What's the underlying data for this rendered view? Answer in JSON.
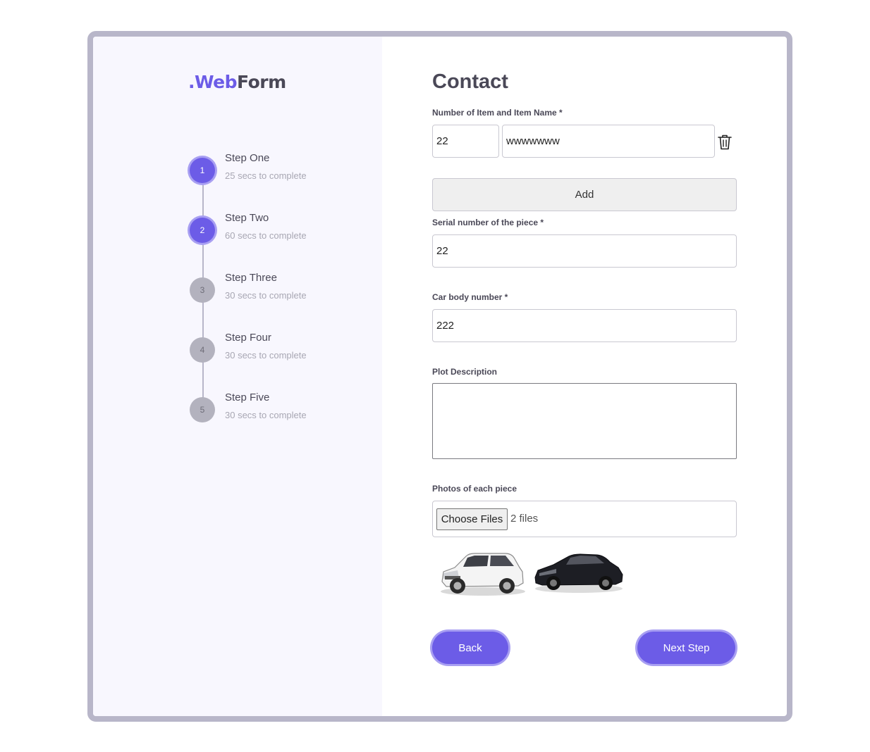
{
  "logo": {
    "part1": ".Web",
    "part2": "Form"
  },
  "steps": [
    {
      "number": "1",
      "title": "Step One",
      "subtitle": "25 secs to complete",
      "state": "active"
    },
    {
      "number": "2",
      "title": "Step Two",
      "subtitle": "60 secs to complete",
      "state": "active"
    },
    {
      "number": "3",
      "title": "Step Three",
      "subtitle": "30 secs to complete",
      "state": "inactive"
    },
    {
      "number": "4",
      "title": "Step Four",
      "subtitle": "30 secs to complete",
      "state": "inactive"
    },
    {
      "number": "5",
      "title": "Step Five",
      "subtitle": "30 secs to complete",
      "state": "inactive"
    }
  ],
  "form": {
    "title": "Contact",
    "item_label": "Number of Item and Item Name *",
    "item_number_value": "22",
    "item_name_value": "wwwwwww",
    "add_label": "Add",
    "serial_label": "Serial number of the piece *",
    "serial_value": "22",
    "body_label": "Car body number *",
    "body_value": "222",
    "plot_label": "Plot Description",
    "plot_value": "",
    "photos_label": "Photos of each piece",
    "choose_files_label": "Choose Files",
    "files_count": "2 files",
    "back_label": "Back",
    "next_label": "Next Step"
  },
  "colors": {
    "accent": "#6c5ce7",
    "accent_ring": "#a89ff2",
    "inactive_step": "#b3b2be",
    "text": "#4a4857",
    "sidebar_bg": "#f8f7fe",
    "card_border": "#b8b6c9"
  },
  "icons": {
    "delete": "trash-icon"
  }
}
